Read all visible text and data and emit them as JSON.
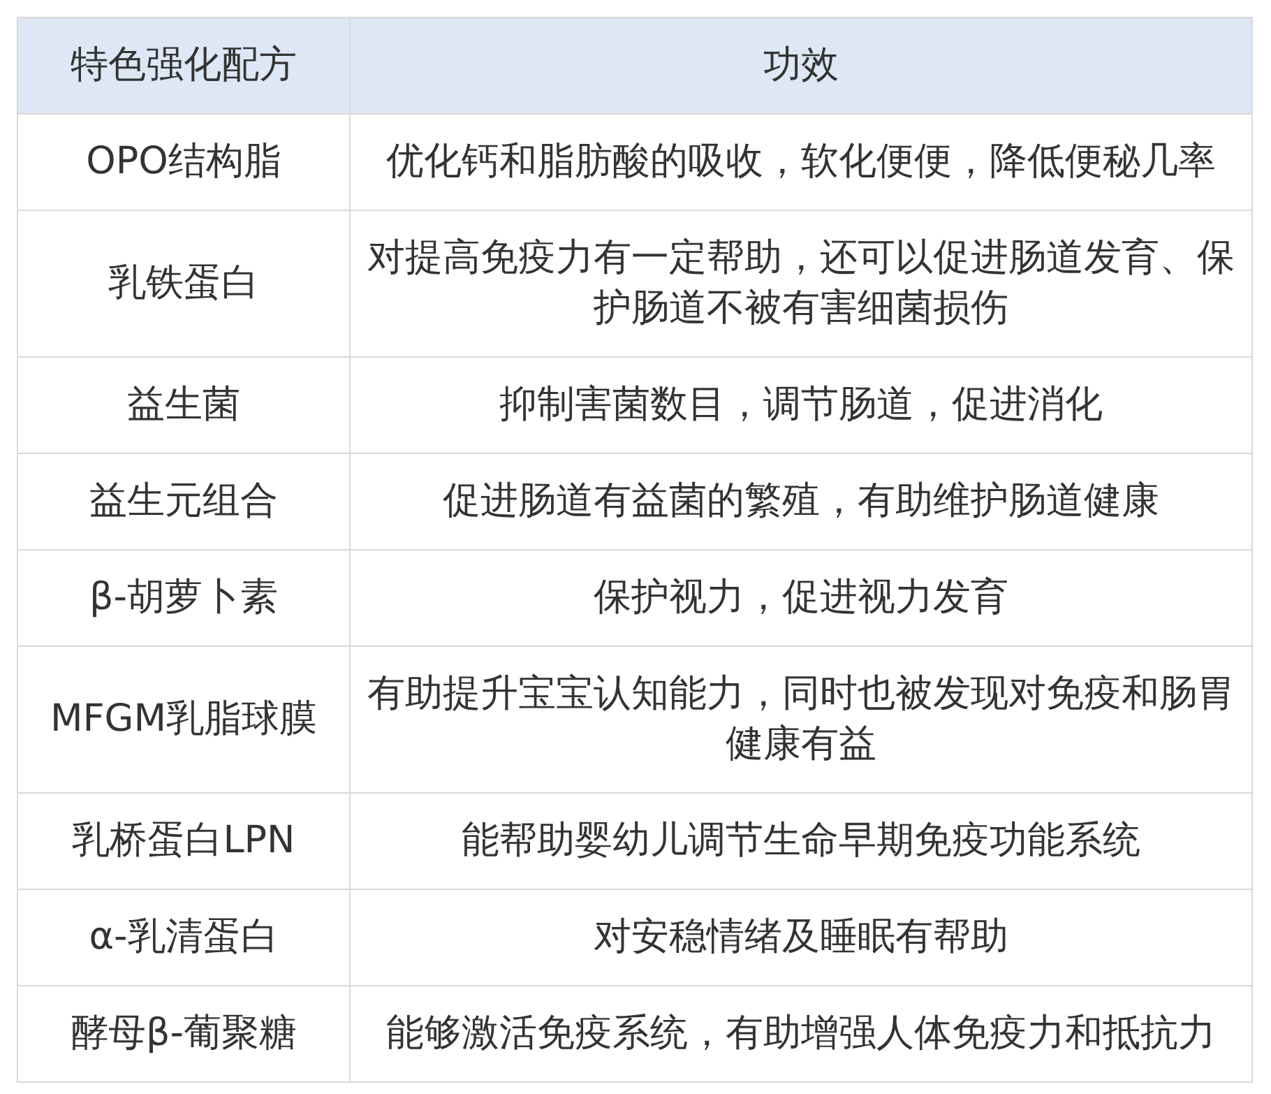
{
  "table": {
    "columns": [
      "特色强化配方",
      "功效"
    ],
    "rows": [
      [
        "OPO结构脂",
        "优化钙和脂肪酸的吸收，软化便便，降低便秘几率"
      ],
      [
        "乳铁蛋白",
        "对提高免疫力有一定帮助，还可以促进肠道发育、保护肠道不被有害细菌损伤"
      ],
      [
        "益生菌",
        "抑制害菌数目，调节肠道，促进消化"
      ],
      [
        "益生元组合",
        "促进肠道有益菌的繁殖，有助维护肠道健康"
      ],
      [
        "β-胡萝卜素",
        "保护视力，促进视力发育"
      ],
      [
        "MFGM乳脂球膜",
        "有助提升宝宝认知能力，同时也被发现对免疫和肠胃健康有益"
      ],
      [
        "乳桥蛋白LPN",
        "能帮助婴幼儿调节生命早期免疫功能系统"
      ],
      [
        "α-乳清蛋白",
        "对安稳情绪及睡眠有帮助"
      ],
      [
        "酵母β-葡聚糖",
        "能够激活免疫系统，有助增强人体免疫力和抵抗力"
      ]
    ]
  }
}
